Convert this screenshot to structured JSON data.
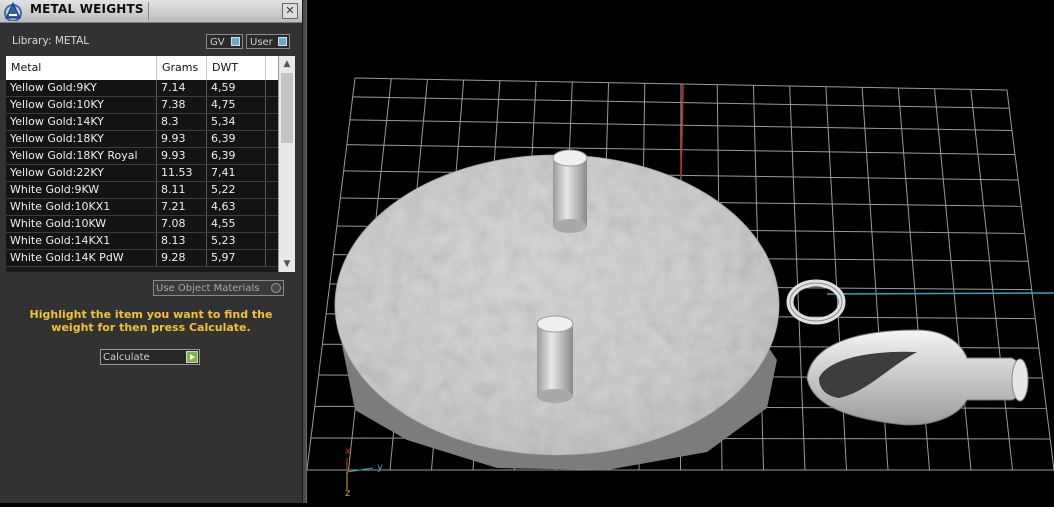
{
  "panel": {
    "title": "METAL WEIGHTS",
    "close_glyph": "✕",
    "library_label": "Library: METAL",
    "toggles": {
      "gv": "GV",
      "user": "User"
    },
    "table": {
      "headers": [
        "Metal",
        "Grams",
        "DWT"
      ],
      "rows": [
        [
          "Yellow Gold:9KY",
          "7.14",
          "4,59"
        ],
        [
          "Yellow Gold:10KY",
          "7.38",
          "4,75"
        ],
        [
          "Yellow Gold:14KY",
          "8.3",
          "5,34"
        ],
        [
          "Yellow Gold:18KY",
          "9.93",
          "6,39"
        ],
        [
          "Yellow Gold:18KY Royal",
          "9.93",
          "6,39"
        ],
        [
          "Yellow Gold:22KY",
          "11.53",
          "7,41"
        ],
        [
          "White Gold:9KW",
          "8.11",
          "5,22"
        ],
        [
          "White Gold:10KX1",
          "7.21",
          "4,63"
        ],
        [
          "White Gold:10KW",
          "7.08",
          "4,55"
        ],
        [
          "White Gold:14KX1",
          "8.13",
          "5,23"
        ],
        [
          "White Gold:14K PdW",
          "9.28",
          "5,97"
        ]
      ]
    },
    "use_object_materials": "Use Object Materials",
    "message": "Highlight the item you want to find the weight for then press Calculate.",
    "calculate_label": "Calculate"
  },
  "viewport": {
    "axis_labels": {
      "x": "x",
      "y": "y",
      "z": "z"
    },
    "colors": {
      "grid": "#9a9a9a",
      "x_axis": "#c0302a",
      "y_axis": "#2aa8b8",
      "model": "#d6d6d6"
    }
  }
}
